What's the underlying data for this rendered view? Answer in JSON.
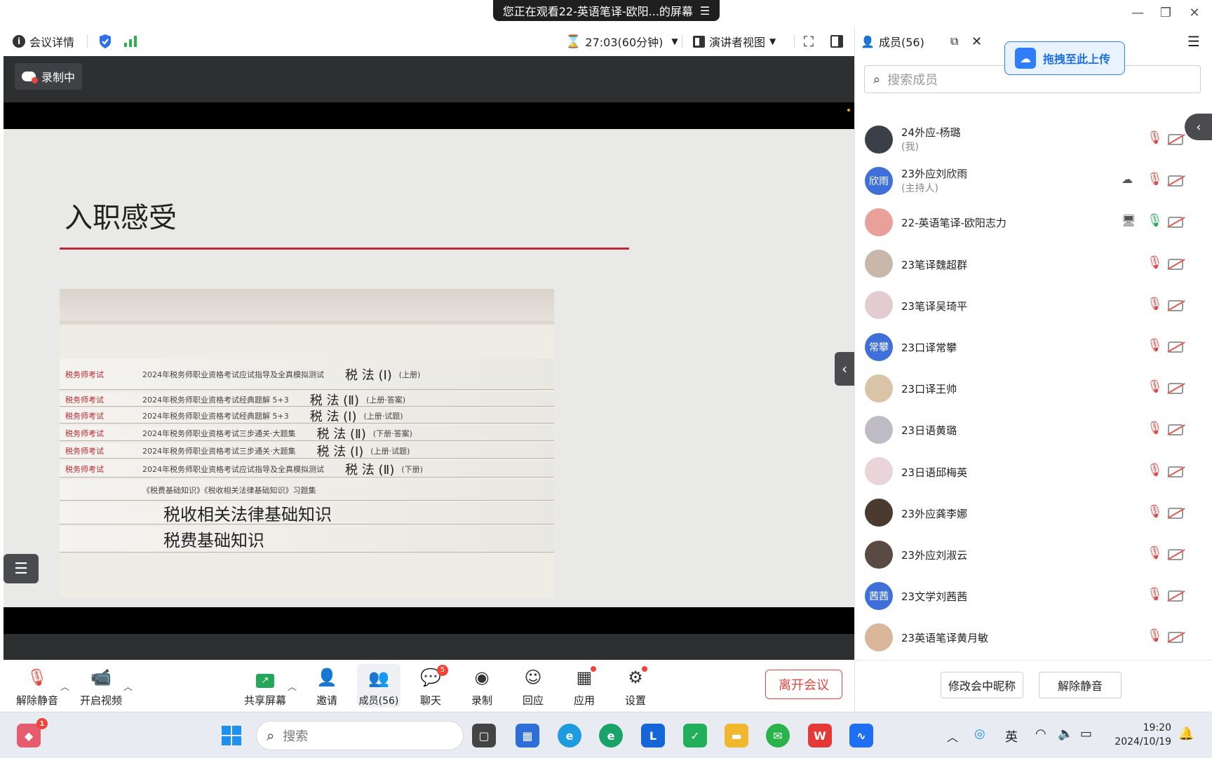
{
  "banner": {
    "text": "您正在观看22-英语笔译-欧阳...的屏幕",
    "icon": "menu-icon"
  },
  "window_controls": {
    "minimize": "—",
    "restore": "❐",
    "close": "✕"
  },
  "toolbar": {
    "meeting_details": "会议详情",
    "timer": "27:03(60分钟)",
    "view_mode": "演讲者视图"
  },
  "stage": {
    "recording_label": "录制中",
    "slide_title": "入职感受",
    "books": [
      {
        "series": "税务师考试",
        "text": "2024年税务师职业资格考试应试指导及全真模拟测试",
        "title": "税 法 (Ⅰ)",
        "vol": "(上册)"
      },
      {
        "series": "税务师考试",
        "text": "2024年税务师职业资格考试经典题解 5+3",
        "title": "税 法 (Ⅱ)",
        "vol": "(上册·答案)"
      },
      {
        "series": "税务师考试",
        "text": "2024年税务师职业资格考试经典题解 5+3",
        "title": "税 法 (Ⅰ)",
        "vol": "(上册·试题)"
      },
      {
        "series": "税务师考试",
        "text": "2024年税务师职业资格考试三步通关·大题集",
        "title": "税 法 (Ⅱ)",
        "vol": "(下册·答案)"
      },
      {
        "series": "税务师考试",
        "text": "2024年税务师职业资格考试三步通关·大题集",
        "title": "税 法 (Ⅰ)",
        "vol": "(上册·试题)"
      },
      {
        "series": "税务师考试",
        "text": "2024年税务师职业资格考试应试指导及全真模拟测试",
        "title": "税 法 (Ⅱ)",
        "vol": "(下册)"
      },
      {
        "series": "",
        "text": "《税费基础知识》《税收相关法律基础知识》习题集",
        "title": "",
        "vol": ""
      },
      {
        "series": "",
        "text": "",
        "title": "税收相关法律基础知识",
        "vol": ""
      },
      {
        "series": "",
        "text": "",
        "title": "税费基础知识",
        "vol": ""
      }
    ]
  },
  "controls": {
    "unmute": "解除静音",
    "start_video": "开启视频",
    "share_screen": "共享屏幕",
    "invite": "邀请",
    "members": "成员(56)",
    "chat": "聊天",
    "chat_badge": "5",
    "record": "录制",
    "reactions": "回应",
    "apps": "应用",
    "settings": "设置",
    "leave": "离开会议"
  },
  "panel": {
    "title": "成员(56)",
    "upload_tip": "拖拽至此上传",
    "search_placeholder": "搜索成员",
    "members": [
      {
        "name": "24外应-杨璐",
        "role": "(我)",
        "avatar": "photo",
        "color": "#3a3f48",
        "initials": ""
      },
      {
        "name": "23外应刘欣雨",
        "role": "(主持人)",
        "avatar": "initials",
        "color": "#3f6fd8",
        "initials": "欣雨"
      },
      {
        "name": "22-英语笔译-欧阳志力",
        "role": "",
        "avatar": "photo",
        "color": "#e9a09a",
        "initials": ""
      },
      {
        "name": "23笔译魏超群",
        "role": "",
        "avatar": "photo",
        "color": "#c9b7ab",
        "initials": ""
      },
      {
        "name": "23笔译吴琦平",
        "role": "",
        "avatar": "photo",
        "color": "#e3ccd0",
        "initials": ""
      },
      {
        "name": "23口译常攀",
        "role": "",
        "avatar": "initials",
        "color": "#3f6fd8",
        "initials": "常攀"
      },
      {
        "name": "23口译王帅",
        "role": "",
        "avatar": "photo",
        "color": "#d9c4a8",
        "initials": ""
      },
      {
        "name": "23日语黄璐",
        "role": "",
        "avatar": "photo",
        "color": "#bfbcc6",
        "initials": ""
      },
      {
        "name": "23日语邱梅英",
        "role": "",
        "avatar": "photo",
        "color": "#e9d4da",
        "initials": ""
      },
      {
        "name": "23外应龚李娜",
        "role": "",
        "avatar": "photo",
        "color": "#4a3a30",
        "initials": ""
      },
      {
        "name": "23外应刘淑云",
        "role": "",
        "avatar": "photo",
        "color": "#5a4a44",
        "initials": ""
      },
      {
        "name": "23文学刘茜茜",
        "role": "",
        "avatar": "initials",
        "color": "#3f6fd8",
        "initials": "茜茜"
      },
      {
        "name": "23英语笔译黄月敏",
        "role": "",
        "avatar": "photo",
        "color": "#d8b79a",
        "initials": ""
      }
    ],
    "rename_button": "修改会中昵称",
    "unmute_button": "解除静音"
  },
  "taskbar": {
    "search_placeholder": "搜索",
    "notification_badge": "1",
    "ime": "英",
    "time": "19:20",
    "date": "2024/10/19"
  },
  "colors": {
    "accent": "#2f7dfa",
    "leave": "#e8453c",
    "record": "#e8453c",
    "stage": "#2e2f31"
  }
}
